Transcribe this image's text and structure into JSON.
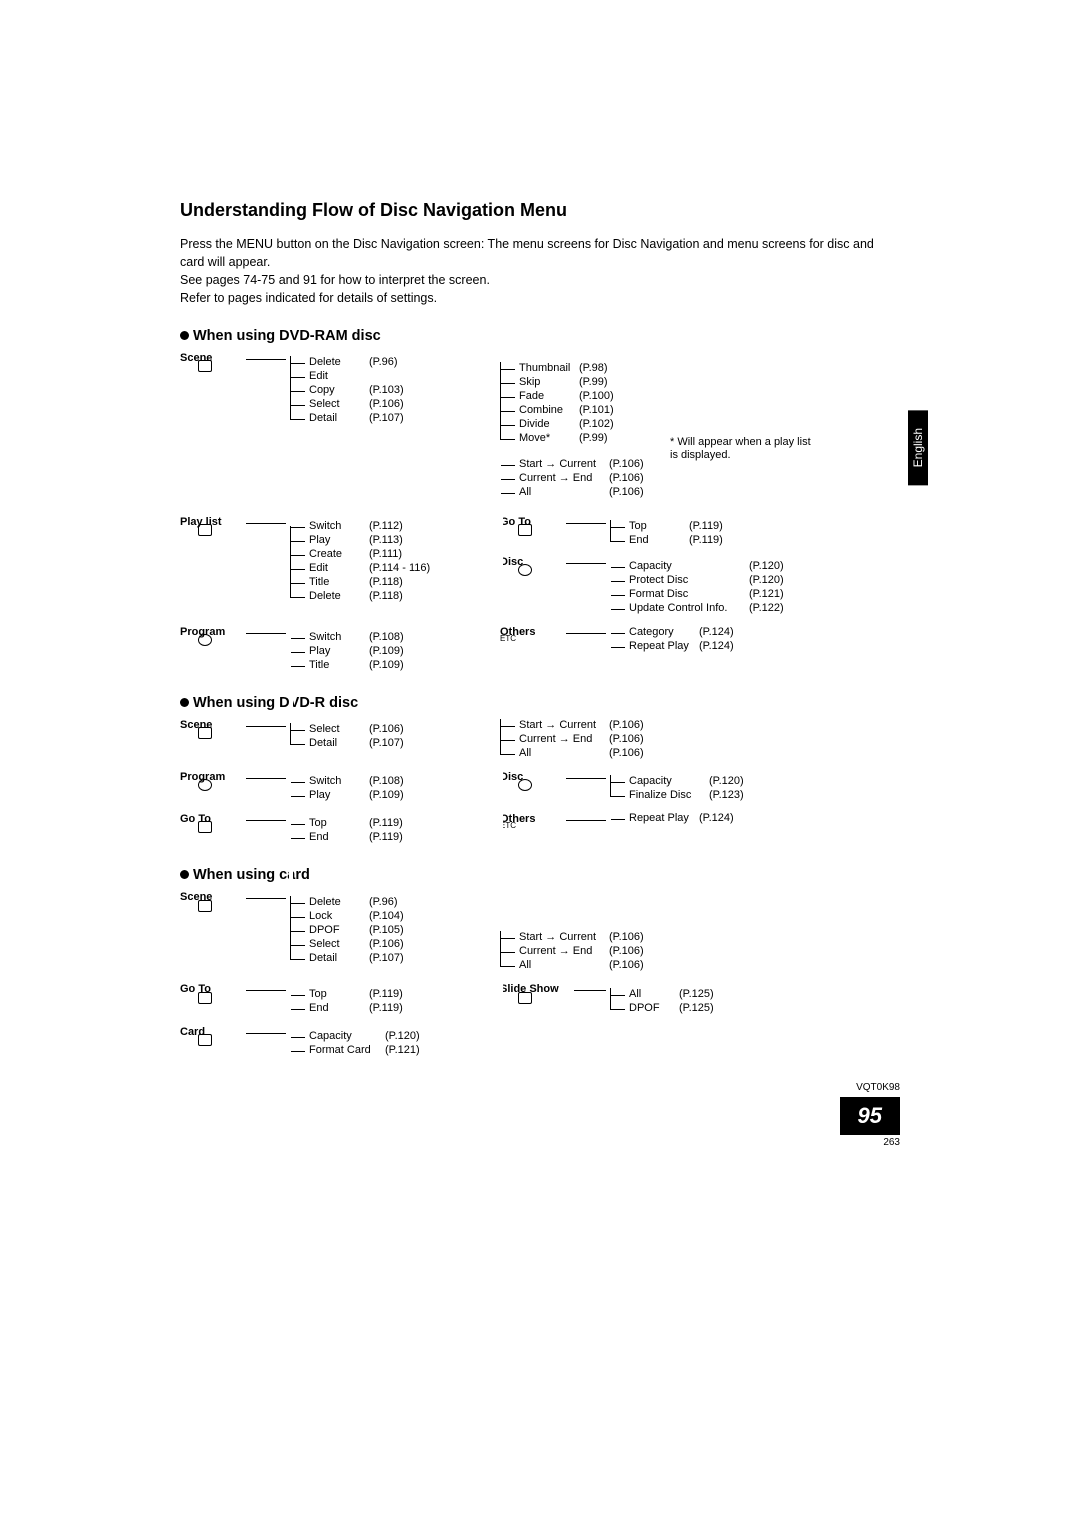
{
  "title": "Understanding Flow of Disc Navigation Menu",
  "intro_lines": [
    "Press the MENU button on the Disc Navigation screen: The menu screens for Disc Navigation and menu screens for disc and card will appear.",
    "See pages 74-75 and 91 for how to interpret the screen.",
    "Refer to pages indicated for details of settings."
  ],
  "lang_tab": "English",
  "doc_code": "VQT0K98",
  "page_big": "95",
  "page_small": "263",
  "footnote": "* Will appear when a play list is displayed.",
  "sections": {
    "dvd_ram": {
      "heading": "When using DVD-RAM disc",
      "scene": {
        "label": "Scene",
        "items": [
          {
            "name": "Delete",
            "page": "(P.96)"
          },
          {
            "name": "Edit",
            "page": ""
          },
          {
            "name": "Copy",
            "page": "(P.103)"
          },
          {
            "name": "Select",
            "page": "(P.106)"
          },
          {
            "name": "Detail",
            "page": "(P.107)"
          }
        ],
        "edit_sub": [
          {
            "name": "Thumbnail",
            "page": "(P.98)"
          },
          {
            "name": "Skip",
            "page": "(P.99)"
          },
          {
            "name": "Fade",
            "page": "(P.100)"
          },
          {
            "name": "Combine",
            "page": "(P.101)"
          },
          {
            "name": "Divide",
            "page": "(P.102)"
          },
          {
            "name": "Move*",
            "page": "(P.99)"
          }
        ],
        "select_sub": [
          {
            "name": "Start → Current",
            "page": "(P.106)"
          },
          {
            "name": "Current → End",
            "page": "(P.106)"
          },
          {
            "name": "All",
            "page": "(P.106)"
          }
        ]
      },
      "playlist": {
        "label": "Play list",
        "items": [
          {
            "name": "Switch",
            "page": "(P.112)"
          },
          {
            "name": "Play",
            "page": "(P.113)"
          },
          {
            "name": "Create",
            "page": "(P.111)"
          },
          {
            "name": "Edit",
            "page": "(P.114 - 116)"
          },
          {
            "name": "Title",
            "page": "(P.118)"
          },
          {
            "name": "Delete",
            "page": "(P.118)"
          }
        ]
      },
      "program": {
        "label": "Program",
        "items": [
          {
            "name": "Switch",
            "page": "(P.108)"
          },
          {
            "name": "Play",
            "page": "(P.109)"
          },
          {
            "name": "Title",
            "page": "(P.109)"
          }
        ]
      },
      "goto": {
        "label": "Go To",
        "items": [
          {
            "name": "Top",
            "page": "(P.119)"
          },
          {
            "name": "End",
            "page": "(P.119)"
          }
        ]
      },
      "disc": {
        "label": "Disc",
        "items": [
          {
            "name": "Capacity",
            "page": "(P.120)"
          },
          {
            "name": "Protect Disc",
            "page": "(P.120)"
          },
          {
            "name": "Format Disc",
            "page": "(P.121)"
          },
          {
            "name": "Update Control Info.",
            "page": "(P.122)"
          }
        ]
      },
      "others": {
        "label": "Others",
        "sub_label": "ETC",
        "items": [
          {
            "name": "Category",
            "page": "(P.124)"
          },
          {
            "name": "Repeat Play",
            "page": "(P.124)"
          }
        ]
      }
    },
    "dvd_r": {
      "heading": "When using DVD-R disc",
      "scene": {
        "label": "Scene",
        "items": [
          {
            "name": "Select",
            "page": "(P.106)"
          },
          {
            "name": "Detail",
            "page": "(P.107)"
          }
        ],
        "select_sub": [
          {
            "name": "Start → Current",
            "page": "(P.106)"
          },
          {
            "name": "Current → End",
            "page": "(P.106)"
          },
          {
            "name": "All",
            "page": "(P.106)"
          }
        ]
      },
      "program": {
        "label": "Program",
        "items": [
          {
            "name": "Switch",
            "page": "(P.108)"
          },
          {
            "name": "Play",
            "page": "(P.109)"
          }
        ]
      },
      "goto": {
        "label": "Go To",
        "items": [
          {
            "name": "Top",
            "page": "(P.119)"
          },
          {
            "name": "End",
            "page": "(P.119)"
          }
        ]
      },
      "disc": {
        "label": "Disc",
        "items": [
          {
            "name": "Capacity",
            "page": "(P.120)"
          },
          {
            "name": "Finalize Disc",
            "page": "(P.123)"
          }
        ]
      },
      "others": {
        "label": "Others",
        "sub_label": "ETC",
        "items": [
          {
            "name": "Repeat Play",
            "page": "(P.124)"
          }
        ]
      }
    },
    "card": {
      "heading": "When using card",
      "scene": {
        "label": "Scene",
        "items": [
          {
            "name": "Delete",
            "page": "(P.96)"
          },
          {
            "name": "Lock",
            "page": "(P.104)"
          },
          {
            "name": "DPOF",
            "page": "(P.105)"
          },
          {
            "name": "Select",
            "page": "(P.106)"
          },
          {
            "name": "Detail",
            "page": "(P.107)"
          }
        ],
        "select_sub": [
          {
            "name": "Start → Current",
            "page": "(P.106)"
          },
          {
            "name": "Current → End",
            "page": "(P.106)"
          },
          {
            "name": "All",
            "page": "(P.106)"
          }
        ]
      },
      "goto": {
        "label": "Go To",
        "items": [
          {
            "name": "Top",
            "page": "(P.119)"
          },
          {
            "name": "End",
            "page": "(P.119)"
          }
        ]
      },
      "card_cat": {
        "label": "Card",
        "items": [
          {
            "name": "Capacity",
            "page": "(P.120)"
          },
          {
            "name": "Format Card",
            "page": "(P.121)"
          }
        ]
      },
      "slideshow": {
        "label": "Slide Show",
        "items": [
          {
            "name": "All",
            "page": "(P.125)"
          },
          {
            "name": "DPOF",
            "page": "(P.125)"
          }
        ]
      }
    }
  }
}
